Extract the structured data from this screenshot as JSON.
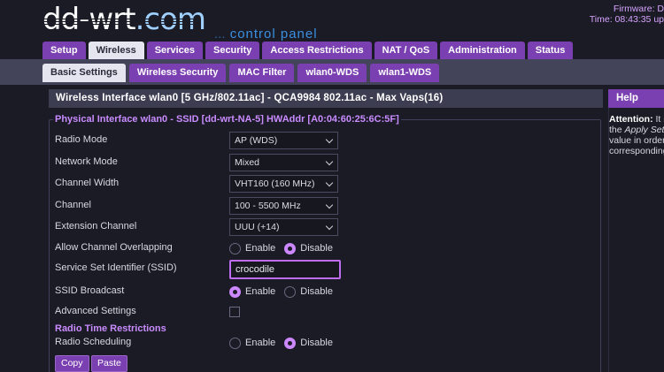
{
  "header": {
    "logo_main": "dd-wrt",
    "logo_dot": ".com",
    "logo_dots": "...",
    "logo_sub": "control panel",
    "firmware_label": "Firmware: D",
    "time_label": "Time: 08:43:35 up"
  },
  "tabs": [
    "Setup",
    "Wireless",
    "Services",
    "Security",
    "Access Restrictions",
    "NAT / QoS",
    "Administration",
    "Status"
  ],
  "subtabs": [
    "Basic Settings",
    "Wireless Security",
    "MAC Filter",
    "wlan0-WDS",
    "wlan1-WDS"
  ],
  "panel": {
    "title": "Wireless Interface wlan0 [5 GHz/802.11ac] - QCA9984 802.11ac - Max Vaps(16)",
    "legend": "Physical Interface wlan0 - SSID [dd-wrt-NA-5] HWAddr [A0:04:60:25:6C:5F]",
    "rows": {
      "radio_mode": {
        "label": "Radio Mode",
        "value": "AP (WDS)"
      },
      "network_mode": {
        "label": "Network Mode",
        "value": "Mixed"
      },
      "channel_width": {
        "label": "Channel Width",
        "value": "VHT160 (160 MHz)"
      },
      "channel": {
        "label": "Channel",
        "value": "100 - 5500 MHz"
      },
      "extension_channel": {
        "label": "Extension Channel",
        "value": "UUU (+14)"
      },
      "allow_overlap": {
        "label": "Allow Channel Overlapping",
        "enable": "Enable",
        "disable": "Disable"
      },
      "ssid": {
        "label": "Service Set Identifier (SSID)",
        "value": "crocodile"
      },
      "ssid_broadcast": {
        "label": "SSID Broadcast",
        "enable": "Enable",
        "disable": "Disable"
      },
      "advanced": {
        "label": "Advanced Settings"
      },
      "radio_time_heading": "Radio Time Restrictions",
      "radio_scheduling": {
        "label": "Radio Scheduling",
        "enable": "Enable",
        "disable": "Disable"
      }
    },
    "buttons": {
      "copy": "Copy",
      "paste": "Paste"
    }
  },
  "help": {
    "title": "Help",
    "attention": "Attention:",
    "line1_tail": "It i",
    "line2_pre": "the",
    "line2_italic": "Apply Settin",
    "line3": "value in order t",
    "line4": "corresponding"
  }
}
